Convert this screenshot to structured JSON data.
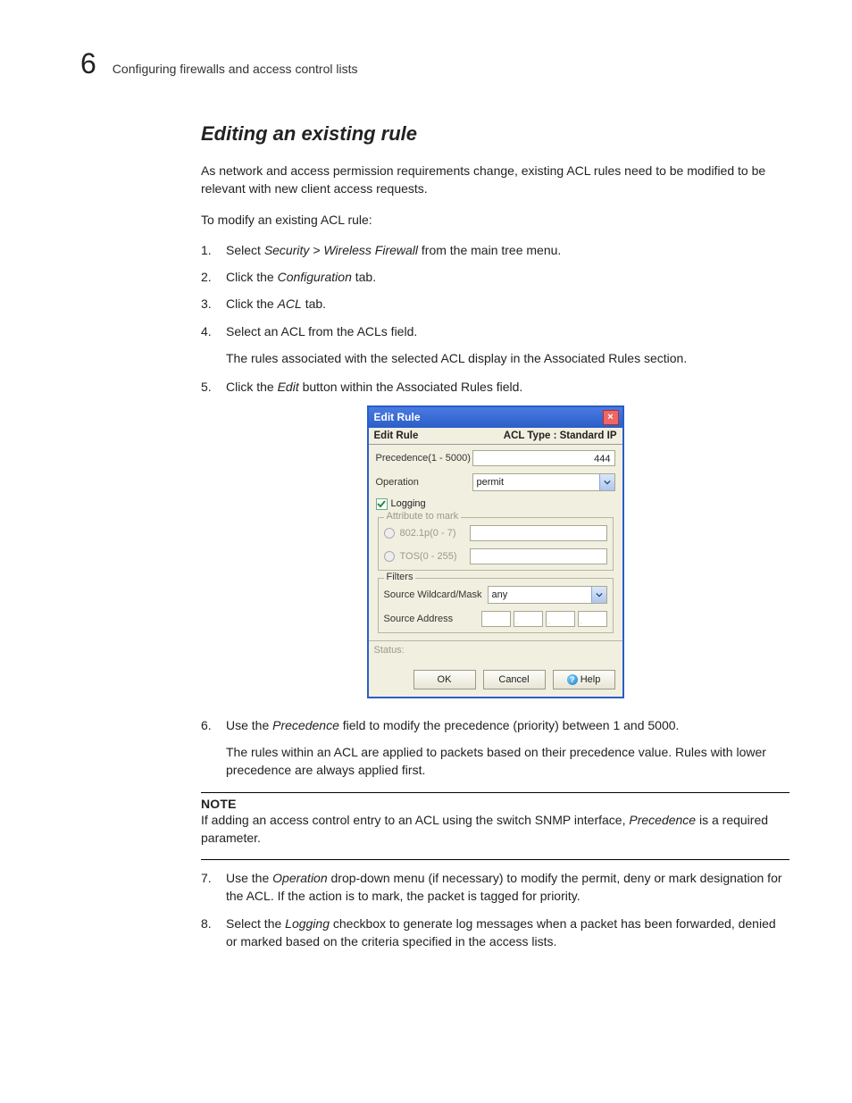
{
  "header": {
    "chapter_number": "6",
    "title": "Configuring firewalls and access control lists"
  },
  "section": {
    "title": "Editing an existing rule",
    "intro": "As network and access permission requirements change, existing ACL rules need to be modified to be relevant with new client access requests.",
    "lead": "To modify an existing ACL rule:"
  },
  "steps": {
    "s1_pre": "Select ",
    "s1_em": "Security > Wireless Firewall",
    "s1_post": " from the main tree menu.",
    "s2_pre": "Click the ",
    "s2_em": "Configuration",
    "s2_post": " tab.",
    "s3_pre": "Click the ",
    "s3_em": "ACL",
    "s3_post": " tab.",
    "s4": "Select an ACL from the ACLs field.",
    "s4_sub": "The rules associated with the selected ACL display in the Associated Rules section.",
    "s5_pre": "Click the ",
    "s5_em": "Edit",
    "s5_post": " button within the Associated Rules field.",
    "s6_pre": "Use the ",
    "s6_em": "Precedence",
    "s6_post": " field to modify the precedence (priority) between 1 and 5000.",
    "s6_sub": "The rules within an ACL are applied to packets based on their precedence value. Rules with lower precedence are always applied first.",
    "s7_pre": "Use the ",
    "s7_em": "Operation",
    "s7_post": " drop-down menu (if necessary) to modify the permit, deny or mark designation for the ACL. If the action is to mark, the packet is tagged for priority.",
    "s8_pre": "Select the ",
    "s8_em": "Logging",
    "s8_post": " checkbox to generate log messages when a packet has been forwarded, denied or marked based on the criteria specified in the access lists."
  },
  "note": {
    "label": "NOTE",
    "body_pre": "If adding an access control entry to an ACL using the switch SNMP interface, ",
    "body_em": "Precedence",
    "body_post": " is a required parameter."
  },
  "dialog": {
    "title": "Edit Rule",
    "sub_left": "Edit Rule",
    "sub_right": "ACL Type : Standard IP",
    "precedence_label": "Precedence(1 - 5000)",
    "precedence_value": "444",
    "operation_label": "Operation",
    "operation_value": "permit",
    "logging_label": "Logging",
    "attr_legend": "Attribute to mark",
    "attr_8021p": "802.1p(0 - 7)",
    "attr_tos": "TOS(0 - 255)",
    "filters_legend": "Filters",
    "source_wildcard_label": "Source Wildcard/Mask",
    "source_wildcard_value": "any",
    "source_address_label": "Source Address",
    "status_label": "Status:",
    "ok": "OK",
    "cancel": "Cancel",
    "help": "Help"
  }
}
